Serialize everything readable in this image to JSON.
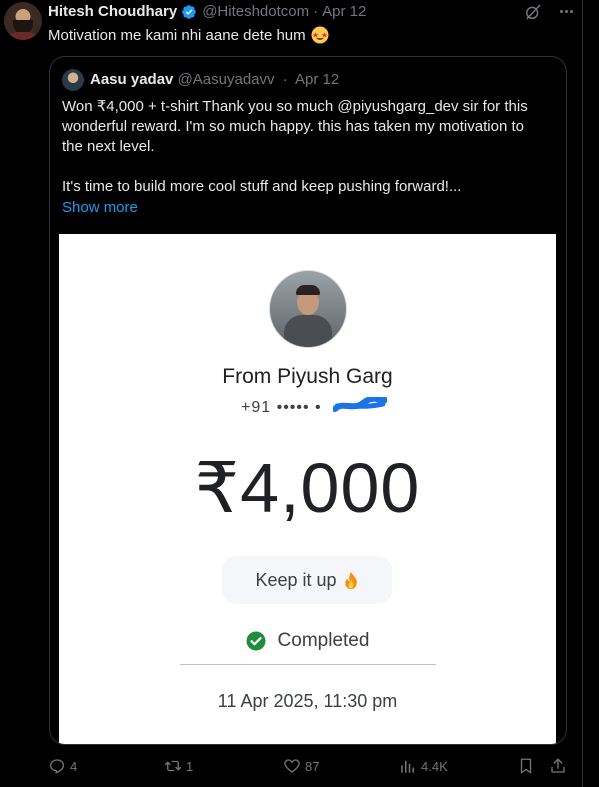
{
  "tweet": {
    "author_name": "Hitesh Choudhary",
    "author_handle": "@Hiteshdotcom",
    "separator": "·",
    "date": "Apr 12",
    "text": "Motivation me kami nhi aane dete hum",
    "emoji": "star-struck-emoji"
  },
  "quote": {
    "author_name": "Aasu yadav",
    "author_handle": "@Aasuyadavv",
    "separator": "·",
    "date": "Apr 12",
    "lines": [
      "Won ₹4,000 + t-shirt Thank you so much @piyushgarg_dev sir for this",
      "wonderful reward. I'm so much happy. this has taken my motivation to",
      "the next level."
    ],
    "line2": "It's time to build more cool stuff and keep pushing forward!...",
    "show_more": "Show more"
  },
  "payment": {
    "from": "From Piyush Garg",
    "phone": "+91 ••••• •",
    "amount": "₹4,000",
    "note": "Keep it up",
    "status": "Completed",
    "datetime": "11 Apr 2025, 11:30 pm"
  },
  "actions": {
    "replies": "4",
    "reposts": "1",
    "likes": "87",
    "views": "4.4K"
  },
  "colors": {
    "background": "#000000",
    "text": "#e7e9ea",
    "muted": "#71767b",
    "link": "#1d9bf0",
    "verified": "#1d9bf0",
    "success": "#1e8e3e",
    "redaction": "#1a73e8"
  }
}
